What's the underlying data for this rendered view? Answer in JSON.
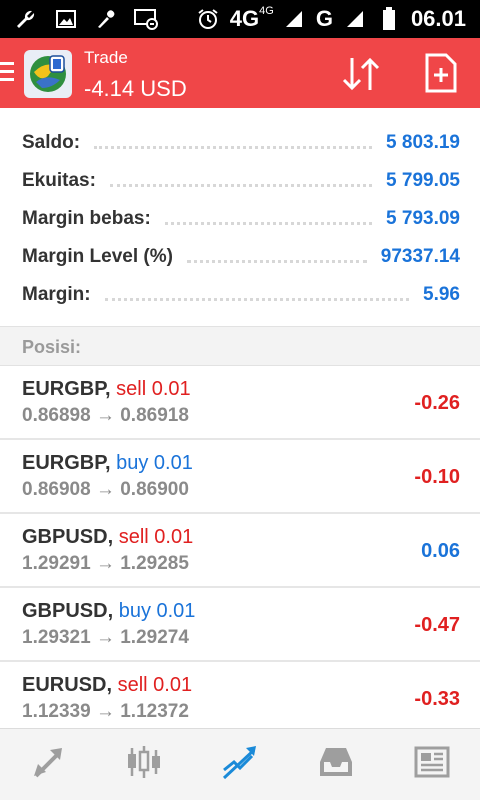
{
  "status_bar": {
    "time": "06.01",
    "network": "4G",
    "network_small": "4G",
    "network2": "G",
    "icons": [
      "wrench-icon",
      "image-icon",
      "microphone-icon",
      "screen-icon",
      "alarm-icon",
      "signal-icon",
      "battery-icon"
    ]
  },
  "header": {
    "title": "Trade",
    "subtitle": "-4.14 USD",
    "accent": "#f04648"
  },
  "summary": [
    {
      "label": "Saldo:",
      "value": "5 803.19"
    },
    {
      "label": "Ekuitas:",
      "value": "5 799.05"
    },
    {
      "label": "Margin bebas:",
      "value": "5 793.09"
    },
    {
      "label": "Margin Level (%)",
      "value": "97337.14"
    },
    {
      "label": "Margin:",
      "value": "5.96"
    }
  ],
  "positions_header": "Posisi:",
  "positions": [
    {
      "symbol": "EURGBP",
      "sep": ",",
      "type": "sell 0.01",
      "side": "sell",
      "prices": "0.86898 → 0.86918",
      "profit": "-0.26",
      "profit_sign": "neg"
    },
    {
      "symbol": "EURGBP",
      "sep": ",",
      "type": "buy 0.01",
      "side": "buy",
      "prices": "0.86908 → 0.86900",
      "profit": "-0.10",
      "profit_sign": "neg"
    },
    {
      "symbol": "GBPUSD",
      "sep": ",",
      "type": "sell 0.01",
      "side": "sell",
      "prices": "1.29291 → 1.29285",
      "profit": "0.06",
      "profit_sign": "pos"
    },
    {
      "symbol": "GBPUSD",
      "sep": ",",
      "type": "buy 0.01",
      "side": "buy",
      "prices": "1.29321 → 1.29274",
      "profit": "-0.47",
      "profit_sign": "neg"
    },
    {
      "symbol": "EURUSD",
      "sep": ",",
      "type": "sell 0.01",
      "side": "sell",
      "prices": "1.12339 → 1.12372",
      "profit": "-0.33",
      "profit_sign": "neg"
    }
  ],
  "bottom_nav": [
    {
      "icon": "quotes-arrows-icon",
      "active": false
    },
    {
      "icon": "candlestick-chart-icon",
      "active": false
    },
    {
      "icon": "trade-trend-icon",
      "active": true
    },
    {
      "icon": "history-inbox-icon",
      "active": false
    },
    {
      "icon": "news-icon",
      "active": false
    }
  ],
  "colors": {
    "positive": "#1a73d9",
    "negative": "#e02020",
    "inactive_icon": "#9e9e9e"
  }
}
